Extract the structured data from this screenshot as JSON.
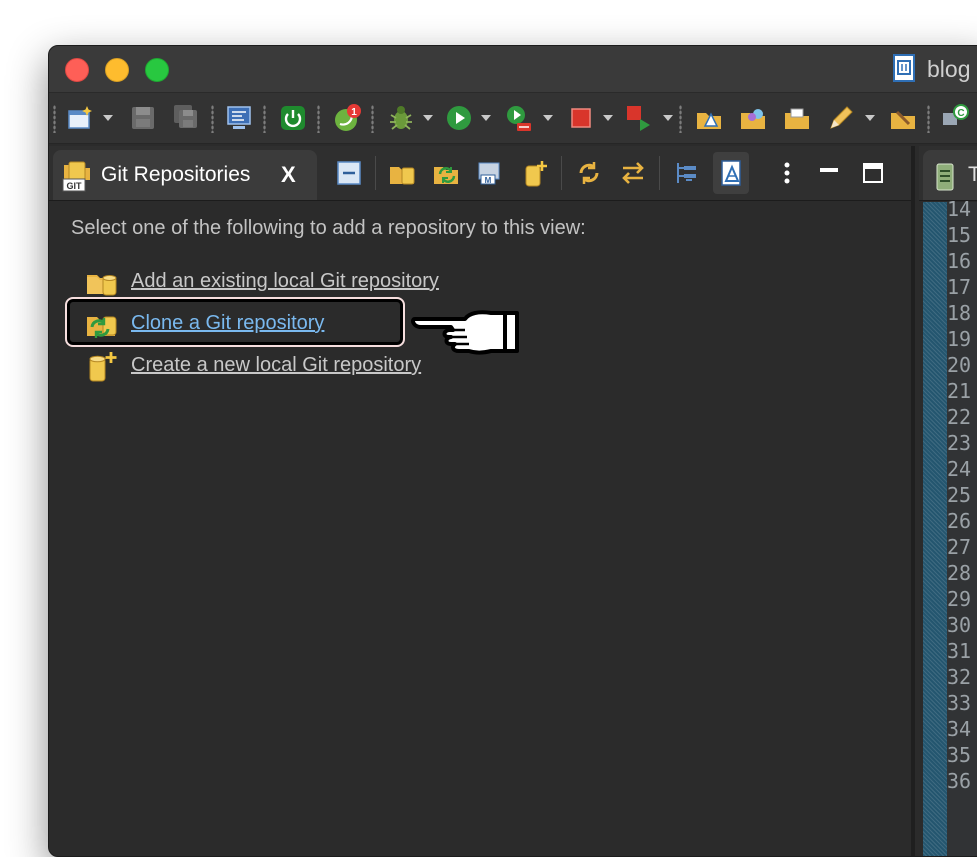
{
  "window": {
    "title": "blog"
  },
  "main_toolbar": {
    "icons": [
      "new-wizard-icon",
      "save-icon",
      "save-all-icon",
      "terminal-icon",
      "power-icon",
      "spring-notifications-icon",
      "debug-icon",
      "run-icon",
      "run-server-icon",
      "stop-icon",
      "external-tools-icon",
      "open-type-icon",
      "open-folder-icon",
      "open-resource-icon",
      "pencil-icon",
      "open-task-icon",
      "perspective-icon"
    ],
    "notification_badge": "1"
  },
  "git_view": {
    "tab_label": "Git Repositories",
    "close_label": "X",
    "toolbar_icons": [
      "collapse-all-icon",
      "add-existing-repo-icon",
      "clone-repo-icon",
      "gerrit-import-icon",
      "create-repo-icon",
      "refresh-icon",
      "link-with-selection-icon",
      "hierarchical-layout-icon",
      "show-properties-icon",
      "view-menu-icon",
      "minimize-icon",
      "maximize-icon"
    ],
    "intro": "Select one of the following to add a repository to this view:",
    "options": [
      {
        "label": "Add an existing local Git repository",
        "icon": "add-existing-repo-icon"
      },
      {
        "label": "Clone a Git repository",
        "icon": "clone-repo-icon",
        "highlighted": true
      },
      {
        "label": "Create a new local Git repository",
        "icon": "create-repo-icon"
      }
    ]
  },
  "editor": {
    "tab_label": "T",
    "line_numbers": [
      "14",
      "15",
      "16",
      "17",
      "18",
      "19",
      "20",
      "21",
      "22",
      "23",
      "24",
      "25",
      "26",
      "27",
      "28",
      "29",
      "30",
      "31",
      "32",
      "33",
      "34",
      "35",
      "36"
    ]
  },
  "colors": {
    "link": "#7ab9ef",
    "panel_bg": "#2b2b2b",
    "highlight_outline": "#f6dede"
  }
}
